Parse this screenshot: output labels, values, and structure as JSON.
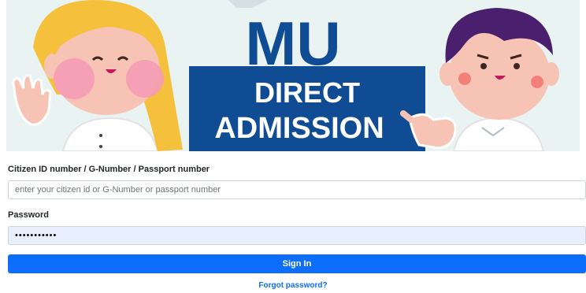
{
  "banner": {
    "title_line1": "MU",
    "title_line2": "DIRECT",
    "title_line3": "ADMISSION"
  },
  "form": {
    "id_label": "Citizen ID number / G-Number / Passport number",
    "id_placeholder": "enter your citizen id or G-Number or passport number",
    "password_label": "Password",
    "password_value": "•••••••••••",
    "signin_label": "Sign In",
    "forgot_label": "Forgot password?"
  },
  "colors": {
    "brand_navy": "#0f4c93",
    "button_blue": "#0d6efd",
    "autofill_bg": "#e8f0fe"
  }
}
